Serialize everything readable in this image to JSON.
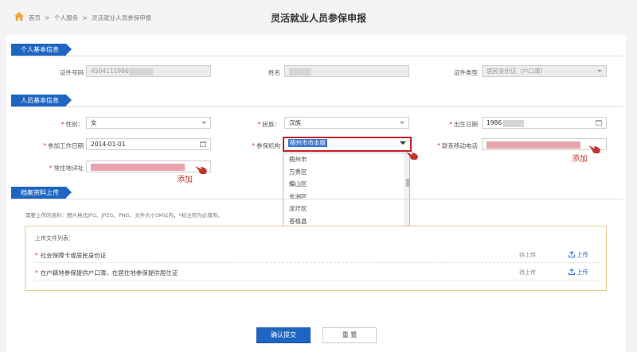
{
  "breadcrumb": {
    "home": "首页",
    "sep": ">",
    "level2": "个人服务",
    "level3": "灵活就业人员参保申报"
  },
  "page_title": "灵活就业人员参保申报",
  "sections": {
    "personal": "个人基本信息",
    "staff": "人员基本信息",
    "archive": "档案资料上传"
  },
  "personal": {
    "id_label": "证件号码",
    "id_value": "4504111986",
    "name_label": "姓名",
    "name_value": "",
    "id_type_label": "证件类型",
    "id_type_value": "居民身份证（户口簿）"
  },
  "staff": {
    "gender_label": "性别：",
    "gender_value": "女",
    "nation_label": "民族：",
    "nation_value": "汉族",
    "birth_label": "出生日期",
    "birth_value": "1986",
    "work_date_label": "参加工作日期",
    "work_date_value": "2014-01-01",
    "agency_label": "参保机构",
    "agency_value": "梧州市市本级",
    "phone_label": "联系移动电话",
    "address_label": "常住地详址"
  },
  "agency_options": [
    "梧州市",
    "万秀区",
    "蝶山区",
    "长洲区",
    "龙圩区",
    "苍梧县"
  ],
  "annotations": {
    "add": "添加"
  },
  "upload": {
    "hint_prefix": "需要上传的资料：图片格式JPG、JPEG、PNG，文件大小5M以内，",
    "hint_required": "*",
    "hint_suffix": "标注项为必填项。",
    "list_title": "上传文件列表：",
    "rows": [
      {
        "name": "社会保障卡或居民身份证",
        "status": "待上传",
        "action": "上传"
      },
      {
        "name": "在户籍地参保提供户口簿，在居住地参保提供居住证",
        "status": "待上传",
        "action": "上传"
      }
    ]
  },
  "buttons": {
    "submit": "确认提交",
    "reset": "重 置"
  },
  "colors": {
    "primary": "#1f66c2",
    "highlight": "#c8202a",
    "annotation": "#c4352e"
  }
}
